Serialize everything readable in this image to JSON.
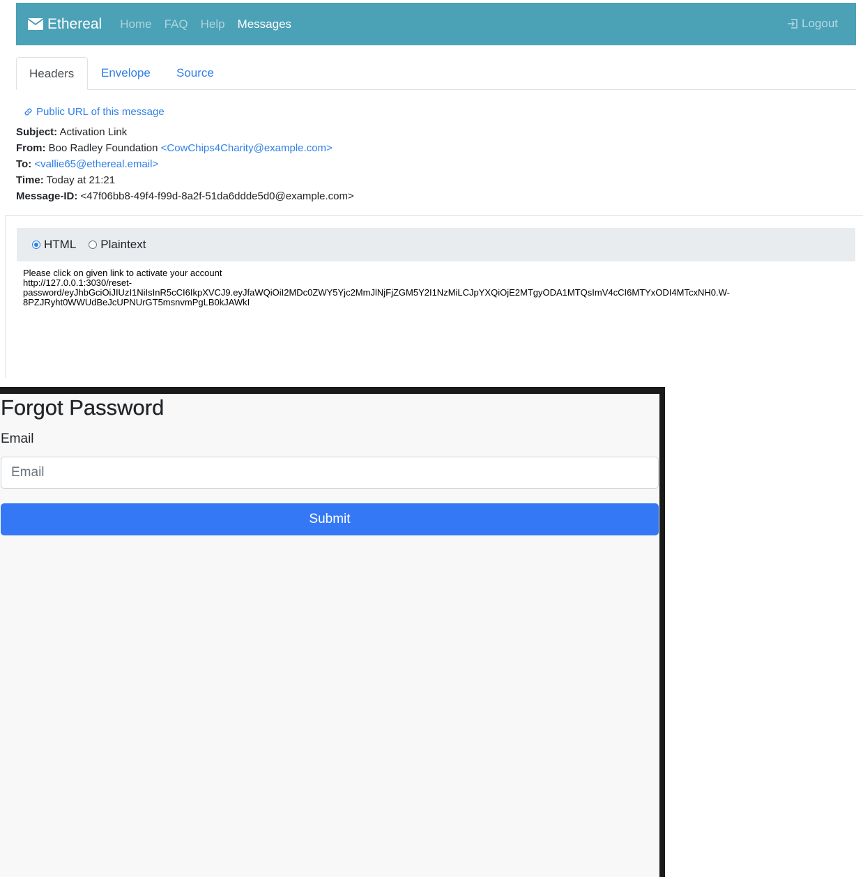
{
  "navbar": {
    "brand": "Ethereal",
    "links": [
      "Home",
      "FAQ",
      "Help",
      "Messages"
    ],
    "active_link": "Messages",
    "logout": "Logout",
    "bg_color": "#4ba1b6"
  },
  "tabs": [
    {
      "label": "Headers",
      "active": true
    },
    {
      "label": "Envelope",
      "active": false
    },
    {
      "label": "Source",
      "active": false
    }
  ],
  "public_url_label": "Public URL of this message",
  "headers": {
    "subject_label": "Subject:",
    "subject": "Activation Link",
    "from_label": "From:",
    "from_name": "Boo Radley Foundation",
    "from_email": "<CowChips4Charity@example.com>",
    "to_label": "To:",
    "to_email": "<vallie65@ethereal.email>",
    "time_label": "Time:",
    "time": "Today at 21:21",
    "message_id_label": "Message-ID:",
    "message_id": "<47f06bb8-49f4-f99d-8a2f-51da6ddde5d0@example.com>"
  },
  "format": {
    "options": [
      "HTML",
      "Plaintext"
    ],
    "selected": "HTML"
  },
  "email_body": {
    "line1": "Please click on given link to activate your account",
    "line2": "http://127.0.0.1:3030/reset-",
    "line3": "password/eyJhbGciOiJIUzI1NiIsInR5cCI6IkpXVCJ9.eyJfaWQiOiI2MDc0ZWY5Yjc2MmJlNjFjZGM5Y2I1NzMiLCJpYXQiOjE2MTgyODA1MTQsImV4cCI6MTYxODI4MTcxNH0.W-",
    "line4": "8PZJRyht0WWUdBeJcUPNUrGT5msnvmPgLB0kJAWkI"
  },
  "forgot_password": {
    "title": "Forgot Password",
    "email_label": "Email",
    "email_placeholder": "Email",
    "email_value": "",
    "submit_label": "Submit",
    "submit_color": "#3478f6"
  }
}
